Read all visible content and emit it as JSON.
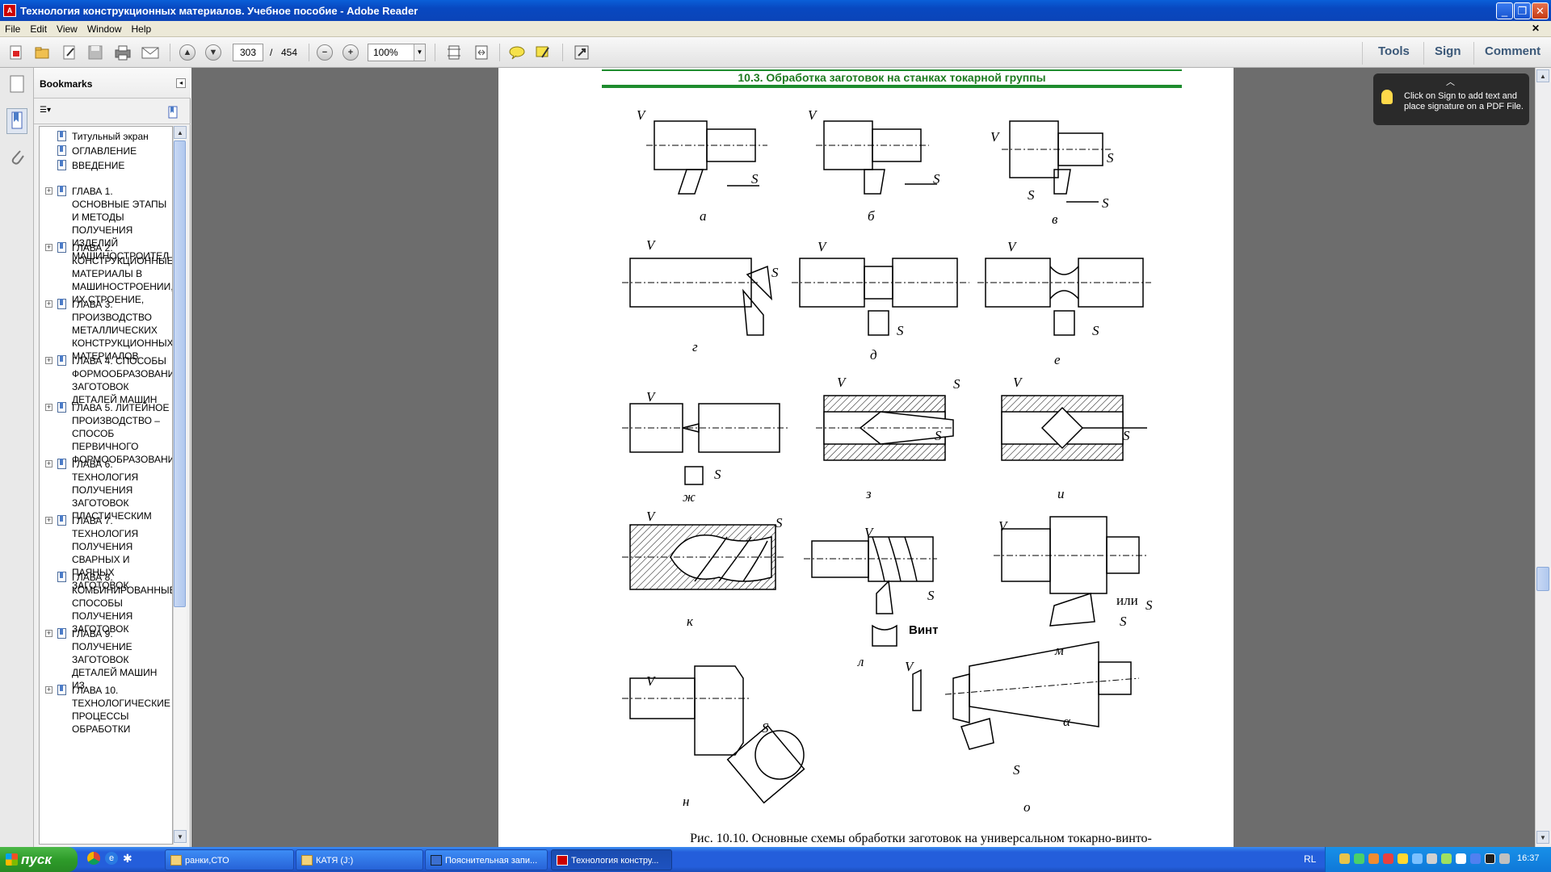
{
  "window": {
    "title": "Технология конструкционных материалов. Учебное пособие - Adobe Reader",
    "app_icon": "adobe-reader-icon"
  },
  "menu": [
    "File",
    "Edit",
    "View",
    "Window",
    "Help"
  ],
  "toolbar": {
    "page_current": "303",
    "page_separator": "/",
    "page_total": "454",
    "zoom": "100%",
    "tools_label": "Tools",
    "sign_label": "Sign",
    "comment_label": "Comment"
  },
  "bookmarks": {
    "title": "Bookmarks",
    "items": [
      {
        "label": "Титульный экран",
        "expandable": false
      },
      {
        "label": "ОГЛАВЛЕНИЕ",
        "expandable": false
      },
      {
        "label": "ВВЕДЕНИЕ",
        "expandable": false
      },
      {
        "label": "ГЛАВА 1. ОСНОВНЫЕ ЭТАПЫ И МЕТОДЫ ПОЛУЧЕНИЯ ИЗДЕЛИЙ МАШИНОСТРОИТЕЛ",
        "expandable": true
      },
      {
        "label": "ГЛАВА 2. КОНСТРУКЦИОННЫЕ МАТЕРИАЛЫ В МАШИНОСТРОЕНИИ, ИХ СТРОЕНИЕ,",
        "expandable": true
      },
      {
        "label": "ГЛАВА 3. ПРОИЗВОДСТВО МЕТАЛЛИЧЕСКИХ КОНСТРУКЦИОННЫХ МАТЕРИАЛОВ",
        "expandable": true
      },
      {
        "label": "ГЛАВА 4. СПОСОБЫ ФОРМООБРАЗОВАНИЯ ЗАГОТОВОК ДЕТАЛЕЙ МАШИН",
        "expandable": true
      },
      {
        "label": "ГЛАВА 5. ЛИТЕЙНОЕ ПРОИЗВОДСТВО – СПОСОБ ПЕРВИЧНОГО ФОРМООБРАЗОВАНИ",
        "expandable": true
      },
      {
        "label": "ГЛАВА 6. ТЕХНОЛОГИЯ ПОЛУЧЕНИЯ ЗАГОТОВОК ПЛАСТИЧЕСКИМ",
        "expandable": true
      },
      {
        "label": "ГЛАВА 7. ТЕХНОЛОГИЯ ПОЛУЧЕНИЯ СВАРНЫХ И ПАЯНЫХ ЗАГОТОВОК",
        "expandable": true
      },
      {
        "label": "ГЛАВА 8. КОМБИНИРОВАННЫЕ СПОСОБЫ ПОЛУЧЕНИЯ ЗАГОТОВОК",
        "expandable": false
      },
      {
        "label": "ГЛАВА 9. ПОЛУЧЕНИЕ ЗАГОТОВОК ДЕТАЛЕЙ МАШИН ИЗ",
        "expandable": true
      },
      {
        "label": "ГЛАВА 10. ТЕХНОЛОГИЧЕСКИЕ ПРОЦЕССЫ ОБРАБОТКИ",
        "expandable": true
      }
    ]
  },
  "document": {
    "section_title": "10.3. Обработка заготовок на станках токарной группы",
    "caption": "Рис. 10.10. Основные схемы обработки заготовок на универсальном токарно-винто-",
    "figure_labels": [
      "а",
      "б",
      "в",
      "г",
      "д",
      "е",
      "ж",
      "з",
      "и",
      "к",
      "л",
      "м",
      "н",
      "о"
    ],
    "v_label": "V",
    "s_label": "S",
    "alpha_label": "α",
    "ili_label": "или",
    "vint_label": "Винт"
  },
  "tooltip": {
    "text": "Click on Sign to add text and place signature on a PDF File."
  },
  "taskbar": {
    "start_label": "пуск",
    "tasks": [
      {
        "label": "ранки,СТО",
        "active": false
      },
      {
        "label": "КАТЯ (J:)",
        "active": false
      },
      {
        "label": "Пояснительная запи...",
        "active": false
      },
      {
        "label": "Технология констру...",
        "active": true
      }
    ],
    "language": "RL",
    "clock": "16:37"
  }
}
